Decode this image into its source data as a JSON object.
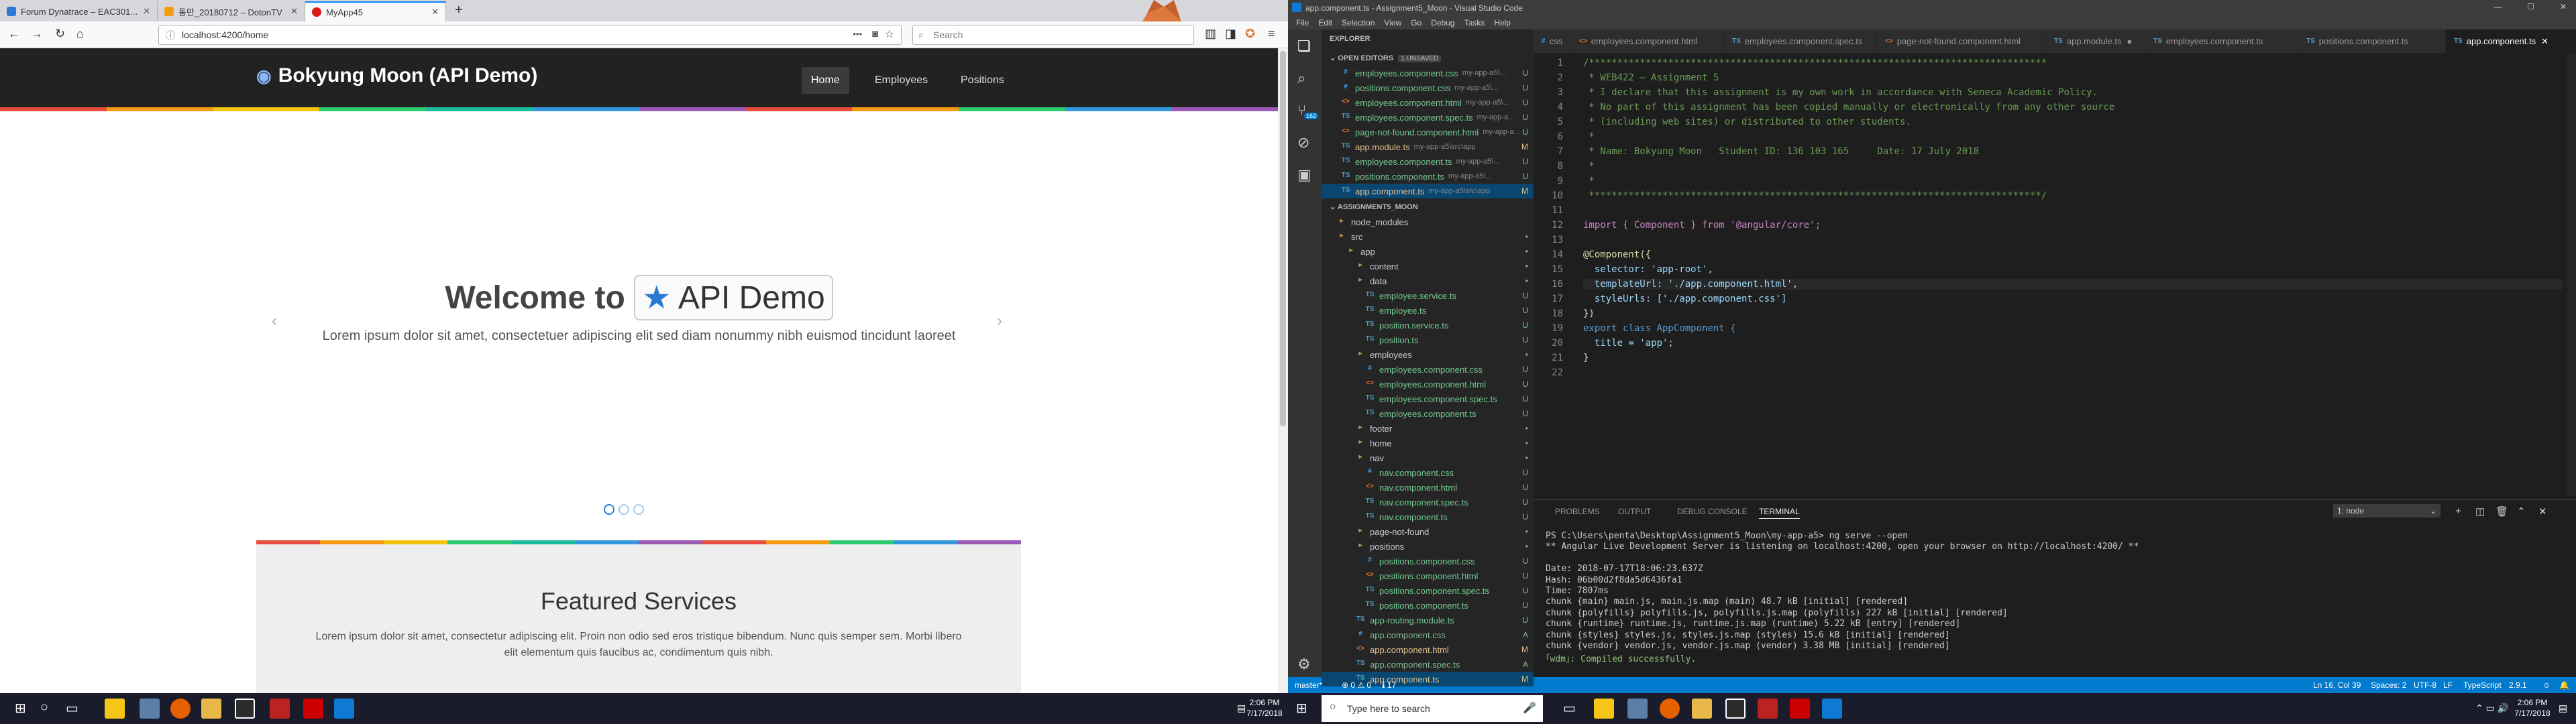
{
  "firefox": {
    "tabs": [
      {
        "title": "Forum Dynatrace – EAC301..."
      },
      {
        "title": "동만_20180712 – DotonTV"
      },
      {
        "title": "MyApp45"
      }
    ],
    "new_tab": "+",
    "url": "localhost:4200/home",
    "search_placeholder": "Search",
    "menu_icon": "≡"
  },
  "site": {
    "brand": "Bokyung Moon (API Demo)",
    "nav": [
      "Home",
      "Employees",
      "Positions"
    ],
    "hero_prefix": "Welcome to",
    "hero_button": "API Demo",
    "hero_sub": "Lorem ipsum dolor sit amet, consectetuer adipiscing elit sed diam nonummy nibh euismod tincidunt laoreet",
    "featured_title": "Featured Services",
    "featured_body": "Lorem ipsum dolor sit amet, consectetur adipiscing elit. Proin non odio sed eros tristique bibendum. Nunc quis semper sem. Morbi libero elit elementum quis faucibus ac, condimentum quis nibh.",
    "stripe_colors": [
      "#e74c3c",
      "#f39c12",
      "#f1c40f",
      "#2ecc71",
      "#1abc9c",
      "#3498db",
      "#9b59b6",
      "#e74c3c",
      "#f39c12",
      "#2ecc71",
      "#3498db",
      "#9b59b6"
    ]
  },
  "vscode": {
    "title": "app.component.ts - Assignment5_Moon - Visual Studio Code",
    "menu": [
      "File",
      "Edit",
      "Selection",
      "View",
      "Go",
      "Debug",
      "Tasks",
      "Help"
    ],
    "explorer_title": "EXPLORER",
    "open_editors": "OPEN EDITORS",
    "unsaved": "1 UNSAVED",
    "open_files": [
      {
        "name": "employees.component.css",
        "path": "my-app-a5\\...",
        "status": "U",
        "icon": "css"
      },
      {
        "name": "positions.component.css",
        "path": "my-app-a5\\...",
        "status": "U",
        "icon": "css"
      },
      {
        "name": "employees.component.html",
        "path": "my-app-a5\\...",
        "status": "U",
        "icon": "html"
      },
      {
        "name": "employees.component.spec.ts",
        "path": "my-app-a...",
        "status": "U",
        "icon": "ts"
      },
      {
        "name": "page-not-found.component.html",
        "path": "my-app-a...",
        "status": "U",
        "icon": "html"
      },
      {
        "name": "app.module.ts",
        "path": "my-app-a5\\src\\app",
        "status": "M",
        "icon": "ts"
      },
      {
        "name": "employees.component.ts",
        "path": "my-app-a5\\...",
        "status": "U",
        "icon": "ts"
      },
      {
        "name": "positions.component.ts",
        "path": "my-app-a5\\...",
        "status": "U",
        "icon": "ts"
      },
      {
        "name": "app.component.ts",
        "path": "my-app-a5\\src\\app",
        "status": "M",
        "icon": "ts"
      }
    ],
    "folder": "ASSIGNMENT5_MOON",
    "tree": [
      {
        "name": "node_modules",
        "indent": 1,
        "icon": "folder",
        "status": ""
      },
      {
        "name": "src",
        "indent": 1,
        "icon": "folder",
        "status": "•"
      },
      {
        "name": "app",
        "indent": 2,
        "icon": "folder",
        "status": "•"
      },
      {
        "name": "content",
        "indent": 3,
        "icon": "folder",
        "status": "•"
      },
      {
        "name": "data",
        "indent": 3,
        "icon": "folder",
        "status": "•"
      },
      {
        "name": "employee.service.ts",
        "indent": 4,
        "icon": "ts",
        "status": "U"
      },
      {
        "name": "employee.ts",
        "indent": 4,
        "icon": "ts",
        "status": "U"
      },
      {
        "name": "position.service.ts",
        "indent": 4,
        "icon": "ts",
        "status": "U"
      },
      {
        "name": "position.ts",
        "indent": 4,
        "icon": "ts",
        "status": "U"
      },
      {
        "name": "employees",
        "indent": 3,
        "icon": "folder",
        "status": "•"
      },
      {
        "name": "employees.component.css",
        "indent": 4,
        "icon": "css",
        "status": "U"
      },
      {
        "name": "employees.component.html",
        "indent": 4,
        "icon": "html",
        "status": "U"
      },
      {
        "name": "employees.component.spec.ts",
        "indent": 4,
        "icon": "ts",
        "status": "U"
      },
      {
        "name": "employees.component.ts",
        "indent": 4,
        "icon": "ts",
        "status": "U"
      },
      {
        "name": "footer",
        "indent": 3,
        "icon": "folder",
        "status": "•"
      },
      {
        "name": "home",
        "indent": 3,
        "icon": "folder",
        "status": "•"
      },
      {
        "name": "nav",
        "indent": 3,
        "icon": "folder",
        "status": "•"
      },
      {
        "name": "nav.component.css",
        "indent": 4,
        "icon": "css",
        "status": "U"
      },
      {
        "name": "nav.component.html",
        "indent": 4,
        "icon": "html",
        "status": "U"
      },
      {
        "name": "nav.component.spec.ts",
        "indent": 4,
        "icon": "ts",
        "status": "U"
      },
      {
        "name": "nav.component.ts",
        "indent": 4,
        "icon": "ts",
        "status": "U"
      },
      {
        "name": "page-not-found",
        "indent": 3,
        "icon": "folder",
        "status": "•"
      },
      {
        "name": "positions",
        "indent": 3,
        "icon": "folder",
        "status": "•"
      },
      {
        "name": "positions.component.css",
        "indent": 4,
        "icon": "css",
        "status": "U"
      },
      {
        "name": "positions.component.html",
        "indent": 4,
        "icon": "html",
        "status": "U"
      },
      {
        "name": "positions.component.spec.ts",
        "indent": 4,
        "icon": "ts",
        "status": "U"
      },
      {
        "name": "positions.component.ts",
        "indent": 4,
        "icon": "ts",
        "status": "U"
      },
      {
        "name": "app-routing.module.ts",
        "indent": 3,
        "icon": "ts",
        "status": "U"
      },
      {
        "name": "app.component.css",
        "indent": 3,
        "icon": "css",
        "status": "A"
      },
      {
        "name": "app.component.html",
        "indent": 3,
        "icon": "html",
        "status": "M"
      },
      {
        "name": "app.component.spec.ts",
        "indent": 3,
        "icon": "ts",
        "status": "A"
      },
      {
        "name": "app.component.ts",
        "indent": 3,
        "icon": "ts",
        "status": "M"
      }
    ],
    "editor_tabs": [
      {
        "name": "css",
        "active": false
      },
      {
        "name": "employees.component.html",
        "active": false
      },
      {
        "name": "employees.component.spec.ts",
        "active": false
      },
      {
        "name": "page-not-found.component.html",
        "active": false
      },
      {
        "name": "app.module.ts",
        "active": false
      },
      {
        "name": "employees.component.ts",
        "active": false
      },
      {
        "name": "positions.component.ts",
        "active": false
      },
      {
        "name": "app.component.ts",
        "active": true
      }
    ],
    "code": [
      {
        "t": "/*********************************************************************************",
        "c": "cm"
      },
      {
        "t": " * WEB422 – Assignment 5",
        "c": "cm"
      },
      {
        "t": " * I declare that this assignment is my own work in accordance with Seneca Academic Policy.",
        "c": "cm"
      },
      {
        "t": " * No part of this assignment has been copied manually or electronically from any other source",
        "c": "cm"
      },
      {
        "t": " * (including web sites) or distributed to other students.",
        "c": "cm"
      },
      {
        "t": " *",
        "c": "cm"
      },
      {
        "t": " * Name: Bokyung Moon   Student ID: 136 103 165     Date: 17 July 2018",
        "c": "cm"
      },
      {
        "t": " *",
        "c": "cm"
      },
      {
        "t": " *",
        "c": "cm"
      },
      {
        "t": " ********************************************************************************/",
        "c": "cm"
      },
      {
        "t": "",
        "c": ""
      },
      {
        "t": "import { Component } from '@angular/core';",
        "c": "imp"
      },
      {
        "t": "",
        "c": ""
      },
      {
        "t": "@Component({",
        "c": "dec"
      },
      {
        "t": "  selector: 'app-root',",
        "c": "prop"
      },
      {
        "t": "  templateUrl: './app.component.html',",
        "c": "prop"
      },
      {
        "t": "  styleUrls: ['./app.component.css']",
        "c": "prop"
      },
      {
        "t": "})",
        "c": ""
      },
      {
        "t": "export class AppComponent {",
        "c": "cls"
      },
      {
        "t": "  title = 'app';",
        "c": "prop"
      },
      {
        "t": "}",
        "c": ""
      },
      {
        "t": "",
        "c": ""
      }
    ],
    "panel_tabs": [
      "PROBLEMS",
      "OUTPUT",
      "DEBUG CONSOLE",
      "TERMINAL"
    ],
    "terminal_select": "1: node",
    "terminal": [
      {
        "t": "PS C:\\Users\\penta\\Desktop\\Assignment5_Moon\\my-app-a5> ng serve --open",
        "c": "#ccc"
      },
      {
        "t": "** Angular Live Development Server is listening on localhost:4200, open your browser on http://localhost:4200/ **",
        "c": "#ccc"
      },
      {
        "t": "",
        "c": "#ccc"
      },
      {
        "t": "Date: 2018-07-17T18:06:23.637Z",
        "c": "#ccc"
      },
      {
        "t": "Hash: 06b00d2f8da5d6436fa1",
        "c": "#ccc"
      },
      {
        "t": "Time: 7807ms",
        "c": "#ccc"
      },
      {
        "t": "chunk {main} main.js, main.js.map (main) 48.7 kB [initial] [rendered]",
        "c": "#ccc"
      },
      {
        "t": "chunk {polyfills} polyfills.js, polyfills.js.map (polyfills) 227 kB [initial] [rendered]",
        "c": "#ccc"
      },
      {
        "t": "chunk {runtime} runtime.js, runtime.js.map (runtime) 5.22 kB [entry] [rendered]",
        "c": "#ccc"
      },
      {
        "t": "chunk {styles} styles.js, styles.js.map (styles) 15.6 kB [initial] [rendered]",
        "c": "#ccc"
      },
      {
        "t": "chunk {vendor} vendor.js, vendor.js.map (vendor) 3.38 MB [initial] [rendered]",
        "c": "#ccc"
      },
      {
        "t": "｢wdm｣: Compiled successfully.",
        "c": "#ccc"
      }
    ],
    "status_left": [
      "master*",
      "⊗ 0 ⚠ 0",
      "ℹ 17"
    ],
    "status_right": [
      "Ln 16, Col 39",
      "Spaces: 2",
      "UTF-8",
      "LF",
      "TypeScript",
      "2.9.1",
      "☺",
      "🔔"
    ]
  },
  "taskbar": {
    "clock_time": "2:06 PM",
    "clock_date": "7/17/2018",
    "search_placeholder": "Type here to search"
  }
}
